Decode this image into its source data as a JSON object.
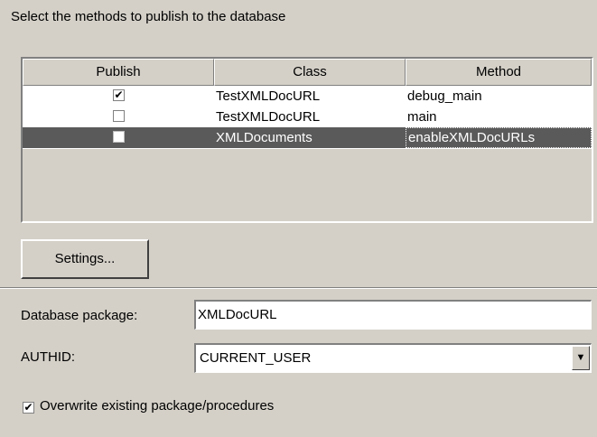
{
  "heading": "Select the methods to publish to the database",
  "table": {
    "columns": [
      "Publish",
      "Class",
      "Method"
    ],
    "rows": [
      {
        "publish": "✔",
        "class": "TestXMLDocURL",
        "method": "debug_main"
      },
      {
        "publish": "",
        "class": "TestXMLDocURL",
        "method": "main"
      },
      {
        "publish": "",
        "class": "XMLDocuments",
        "method": "enableXMLDocURLs"
      }
    ]
  },
  "settings_button": "Settings...",
  "package": {
    "label": "Database package:",
    "value": "XMLDocURL"
  },
  "authid": {
    "label": "AUTHID:",
    "value": "CURRENT_USER",
    "dropdown_glyph": "▼"
  },
  "overwrite": {
    "checked_glyph": "✔",
    "label": "Overwrite existing package/procedures"
  }
}
